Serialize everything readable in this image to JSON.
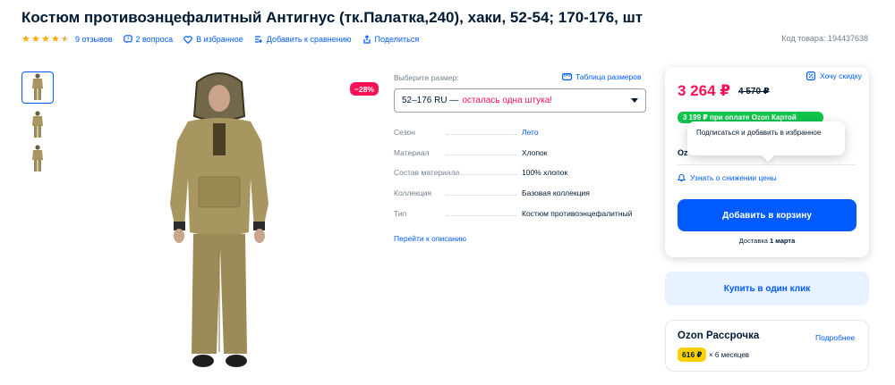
{
  "product": {
    "title": "Костюм противоэнцефалитный Антигнус (тк.Палатка,240), хаки, 52-54; 170-176, шт",
    "sku_text": "Код товара: 194437638"
  },
  "info_row": {
    "rating": 4.5,
    "reviews": "9 отзывов",
    "questions": "2 вопроса",
    "favorite": "В избранное",
    "compare": "Добавить к сравнению",
    "share": "Поделиться"
  },
  "gallery": {
    "discount_badge": "−28%"
  },
  "size": {
    "label": "Выберите размер:",
    "table_link": "Таблица размеров",
    "selected": "52–176 RU —",
    "selected_note": "осталась одна штука!"
  },
  "specs": [
    {
      "key": "Сезон",
      "value": "Лето",
      "link": true
    },
    {
      "key": "Материал",
      "value": "Хлопок",
      "link": false
    },
    {
      "key": "Состав материала",
      "value": "100% хлопок",
      "link": false
    },
    {
      "key": "Коллекция",
      "value": "Базовая коллекция",
      "link": false
    },
    {
      "key": "Тип",
      "value": "Костюм противоэнцефалитный",
      "link": false
    }
  ],
  "go_description": "Перейти к описанию",
  "buy_card": {
    "price": "3 264 ₽",
    "old_price": "4 570 ₽",
    "want_discount": "Хочу скидку",
    "ozon_card_price": "3 199 ₽ при оплате Ozon Картой",
    "tooltip": "Подписаться и добавить в избранное",
    "hidden_peek": "Oz",
    "price_alert": "Узнать о снижении цены",
    "add_to_cart": "Добавить в корзину",
    "delivery_prefix": "Доставка",
    "delivery_date": "1 марта",
    "one_click": "Купить в один клик"
  },
  "installment": {
    "title": "Ozon Рассрочка",
    "more": "Подробнее",
    "amount": "616 ₽",
    "months": "× 6 месяцев"
  },
  "colors": {
    "accent": "#005bff",
    "sale": "#f91155",
    "ozon_card": "#10c44c",
    "installment_badge": "#ffd000",
    "suit": "#a89660"
  }
}
